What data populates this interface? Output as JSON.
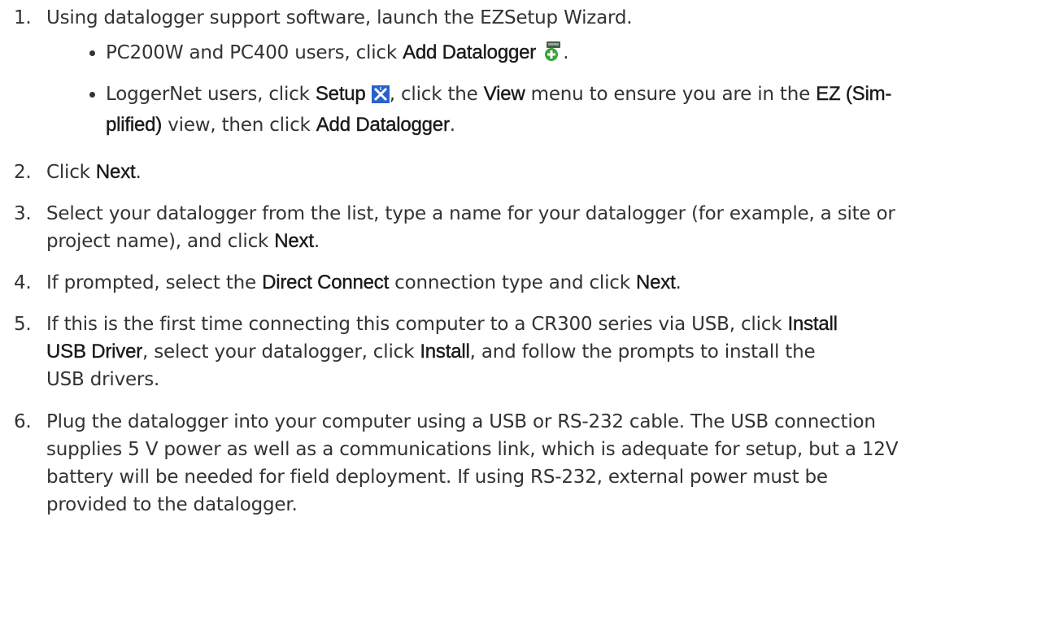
{
  "steps": [
    {
      "number": "1.",
      "text_a": "Using datalogger support software, launch the EZSetup Wizard.",
      "bullets": [
        {
          "text_a": "PC200W and PC400 users, click ",
          "bold_a": "Add Datalogger",
          "icon": "add-datalogger-icon",
          "text_b": "."
        },
        {
          "text_a": "LoggerNet users, click ",
          "bold_a": "Setup",
          "icon": "setup-icon",
          "text_b": ", click the ",
          "bold_b": "View",
          "text_c": " menu to ensure you are in the ",
          "bold_c": "EZ (Sim-",
          "bold_d": "plified)",
          "text_d": " view, then click ",
          "bold_e": "Add Datalogger",
          "text_e": "."
        }
      ]
    },
    {
      "number": "2.",
      "text_a": "Click ",
      "bold_a": "Next",
      "text_b": "."
    },
    {
      "number": "3.",
      "text_a": "Select your datalogger from the list, type a name for your datalogger (for example, a site or",
      "text_b": "project name), and click ",
      "bold_a": "Next",
      "text_c": "."
    },
    {
      "number": "4.",
      "text_a": "If prompted, select the ",
      "bold_a": "Direct Connect",
      "text_b": " connection type and click ",
      "bold_b": "Next",
      "text_c": "."
    },
    {
      "number": "5.",
      "text_a": "If this is the first time connecting this computer to a CR300 series via USB, click ",
      "bold_a": "Install",
      "bold_b": "USB Driver",
      "text_b": ", select your datalogger, click ",
      "bold_c": "Install",
      "text_c": ", and follow the prompts to install the",
      "text_d": "USB drivers."
    },
    {
      "number": "6.",
      "line_1": "Plug the datalogger into your computer using a USB or RS-232 cable. The USB connection",
      "line_2": "supplies 5 V power as well as a communications link, which is adequate for setup, but a 12V",
      "line_3": "battery will be needed for field deployment. If using RS-232, external power must be",
      "line_4": "provided to the datalogger."
    }
  ],
  "colors": {
    "text": "#333333",
    "bold": "#1a1a1a",
    "icon_green": "#3aa23a",
    "icon_blue": "#2a62c9"
  }
}
